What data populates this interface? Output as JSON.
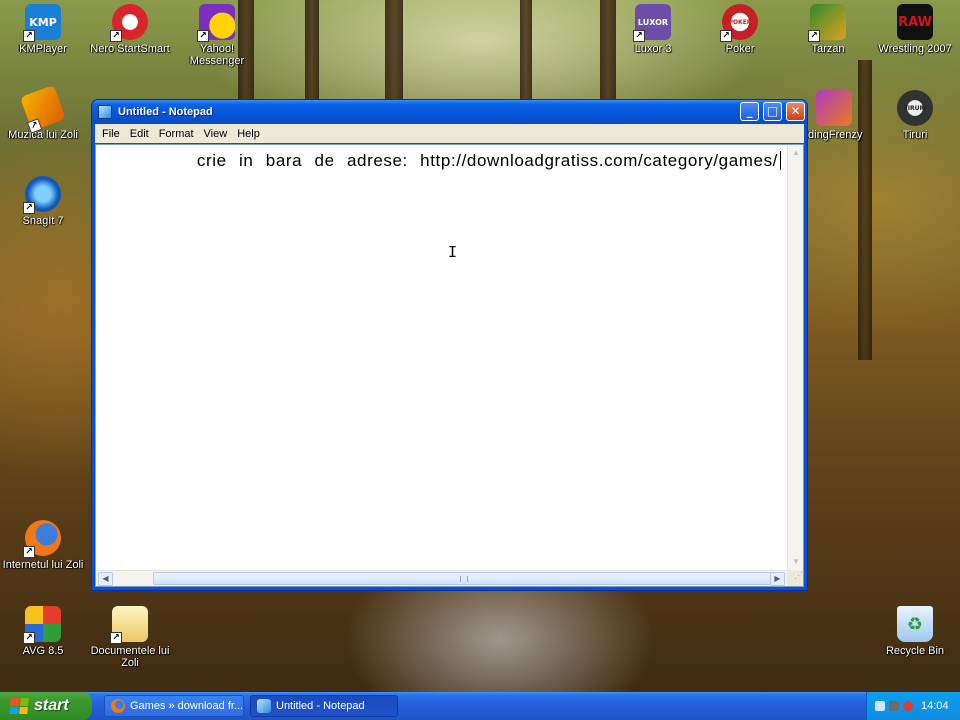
{
  "desktop": {
    "icons": [
      {
        "label": "KMPlayer"
      },
      {
        "label": "Nero StartSmart"
      },
      {
        "label": "Yahoo! Messenger"
      },
      {
        "label": "Luxor 3"
      },
      {
        "label": "Poker"
      },
      {
        "label": "Tarzan"
      },
      {
        "label": "Wrestling 2007"
      },
      {
        "label": "Muzica lui Zoli"
      },
      {
        "label": "ldingFrenzy"
      },
      {
        "label": "Tiruri"
      },
      {
        "label": "SnagIt 7"
      },
      {
        "label": "Internetul lui Zoli"
      },
      {
        "label": "AVG 8.5"
      },
      {
        "label": "Documentele lui Zoli"
      },
      {
        "label": "Recycle Bin"
      }
    ],
    "icon_art": {
      "kmplayer": "KMP",
      "luxor": "LUXOR",
      "poker": "POKER",
      "wrestling": "RAW",
      "tiruri": "TIRURI"
    }
  },
  "notepad": {
    "title": "Untitled - Notepad",
    "menu": [
      "File",
      "Edit",
      "Format",
      "View",
      "Help"
    ],
    "text": "crie in bara de adrese: http://downloadgratiss.com/category/games/",
    "window_buttons": {
      "minimize": "_",
      "maximize": "□",
      "close": "✕"
    }
  },
  "taskbar": {
    "start_label": "start",
    "items": [
      {
        "label": "Games » download fr..."
      },
      {
        "label": "Untitled - Notepad"
      }
    ],
    "clock": "14:04"
  },
  "colors": {
    "titlebar": "#0a62e8",
    "taskbar": "#245edb",
    "start_button": "#3b9a30",
    "tray": "#0f8ae0",
    "close_button": "#cf3d14"
  }
}
